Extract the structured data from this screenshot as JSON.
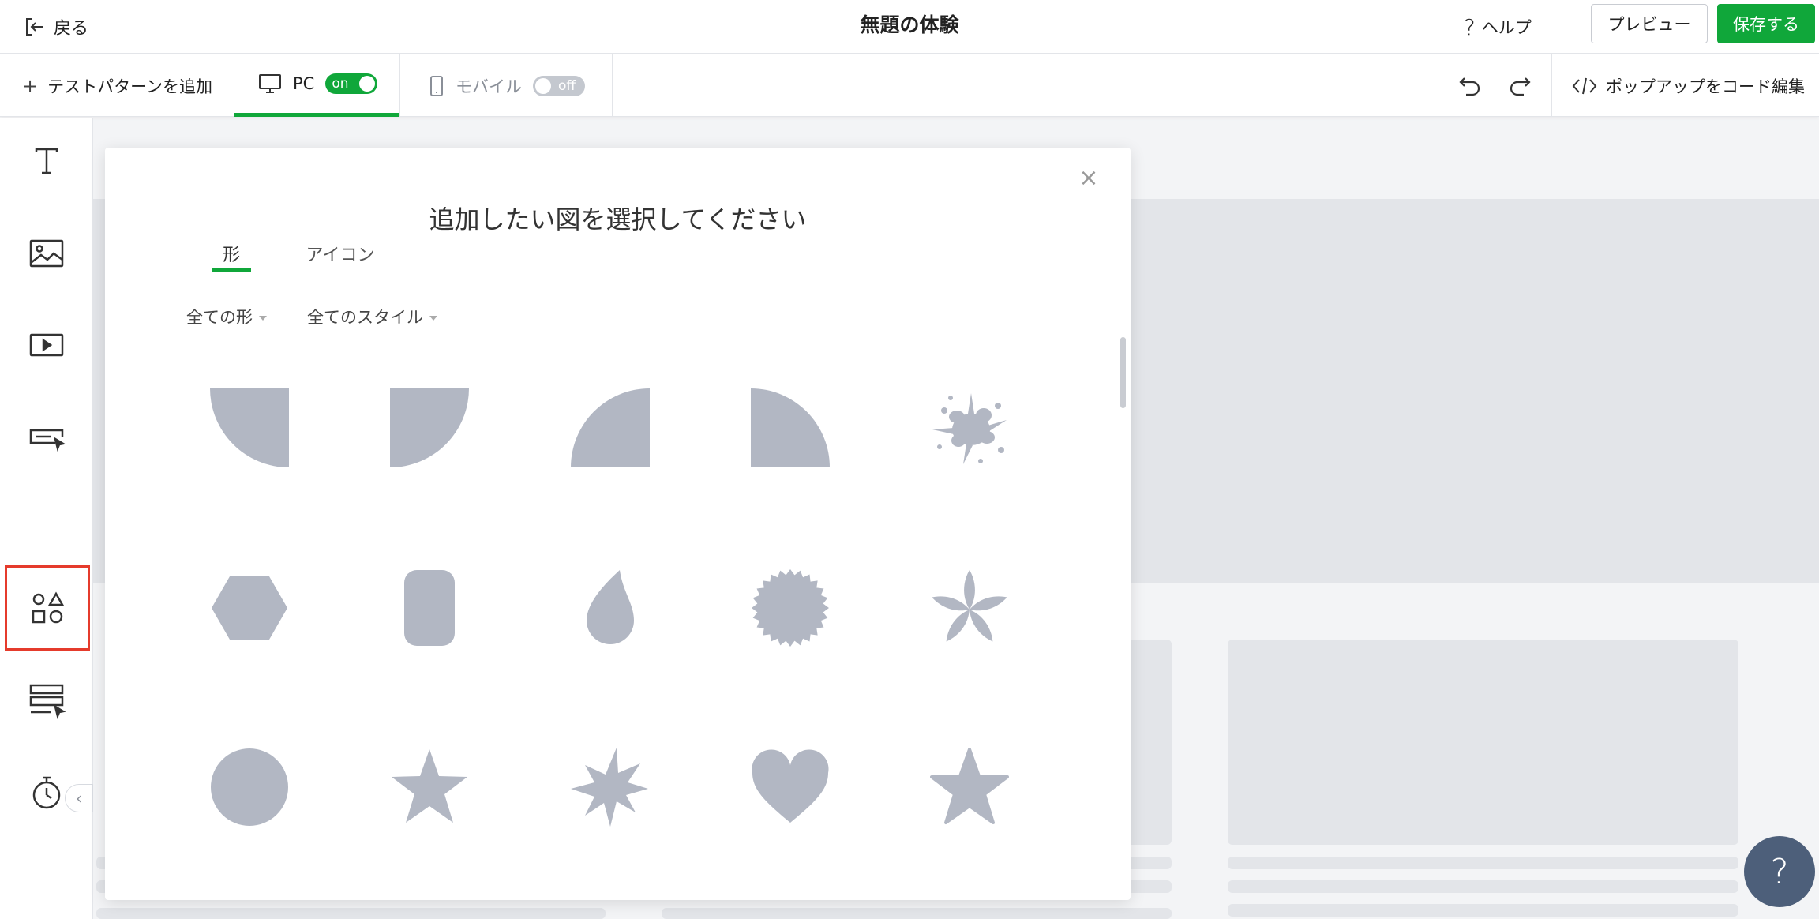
{
  "header": {
    "back_label": "戻る",
    "title": "無題の体験",
    "help_label": "ヘルプ",
    "preview_label": "プレビュー",
    "save_label": "保存する"
  },
  "toolbar": {
    "add_pattern_label": "テストパターンを追加",
    "pc_label": "PC",
    "pc_toggle": "on",
    "mobile_label": "モバイル",
    "mobile_toggle": "off",
    "code_edit_label": "ポップアップをコード編集"
  },
  "sidebar": {
    "items": [
      {
        "icon": "text-icon"
      },
      {
        "icon": "image-icon"
      },
      {
        "icon": "video-icon"
      },
      {
        "icon": "button-icon"
      },
      {
        "icon": "shapes-icon",
        "selected": true
      },
      {
        "icon": "form-icon"
      },
      {
        "icon": "timer-icon"
      }
    ]
  },
  "modal": {
    "title": "追加したい図を選択してください",
    "tabs": [
      {
        "label": "形",
        "active": true
      },
      {
        "label": "アイコン",
        "active": false
      }
    ],
    "filters": [
      {
        "label": "全ての形"
      },
      {
        "label": "全てのスタイル"
      }
    ],
    "shape_color": "#b2b7c3",
    "shapes": [
      "quarter-circle-bottom-left",
      "quarter-circle-bottom-right",
      "quarter-circle-top-left",
      "quarter-circle-top-right",
      "splash",
      "hexagon",
      "rounded-rectangle",
      "drop",
      "starburst-badge",
      "flower",
      "circle",
      "star",
      "explosion",
      "heart",
      "star-rounded"
    ]
  },
  "help_bubble": "?",
  "colors": {
    "accent": "#10a73a",
    "selected_border": "#e53b2c"
  }
}
